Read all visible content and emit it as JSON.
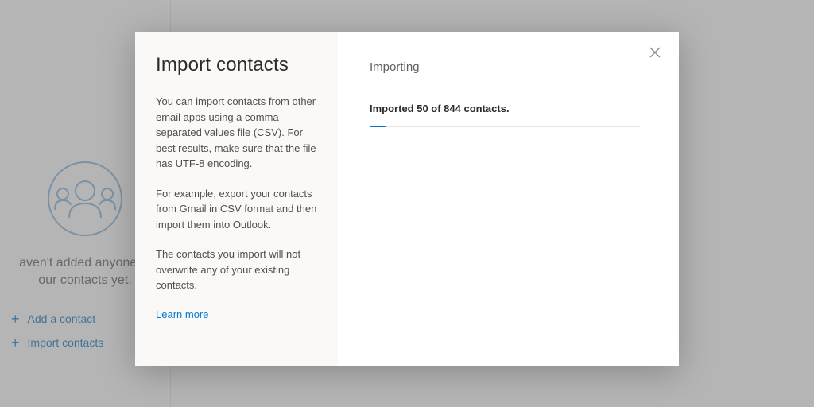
{
  "colors": {
    "accent": "#0078d4",
    "link": "#0078d4"
  },
  "background_page": {
    "status_line1": "aven't added anyone to",
    "status_line2": "our contacts yet.",
    "actions": {
      "add_contact": "Add a contact",
      "import_contacts": "Import contacts"
    }
  },
  "dialog": {
    "title": "Import contacts",
    "para1": "You can import contacts from other email apps using a comma separated values file (CSV). For best results, make sure that the file has UTF-8 encoding.",
    "para2": "For example, export your contacts from Gmail in CSV format and then import them into Outlook.",
    "para3": "The contacts you import will not overwrite any of your existing contacts.",
    "learn_more": "Learn more",
    "right": {
      "heading": "Importing",
      "status": "Imported 50 of 844 contacts.",
      "progress_percent": 6
    }
  }
}
